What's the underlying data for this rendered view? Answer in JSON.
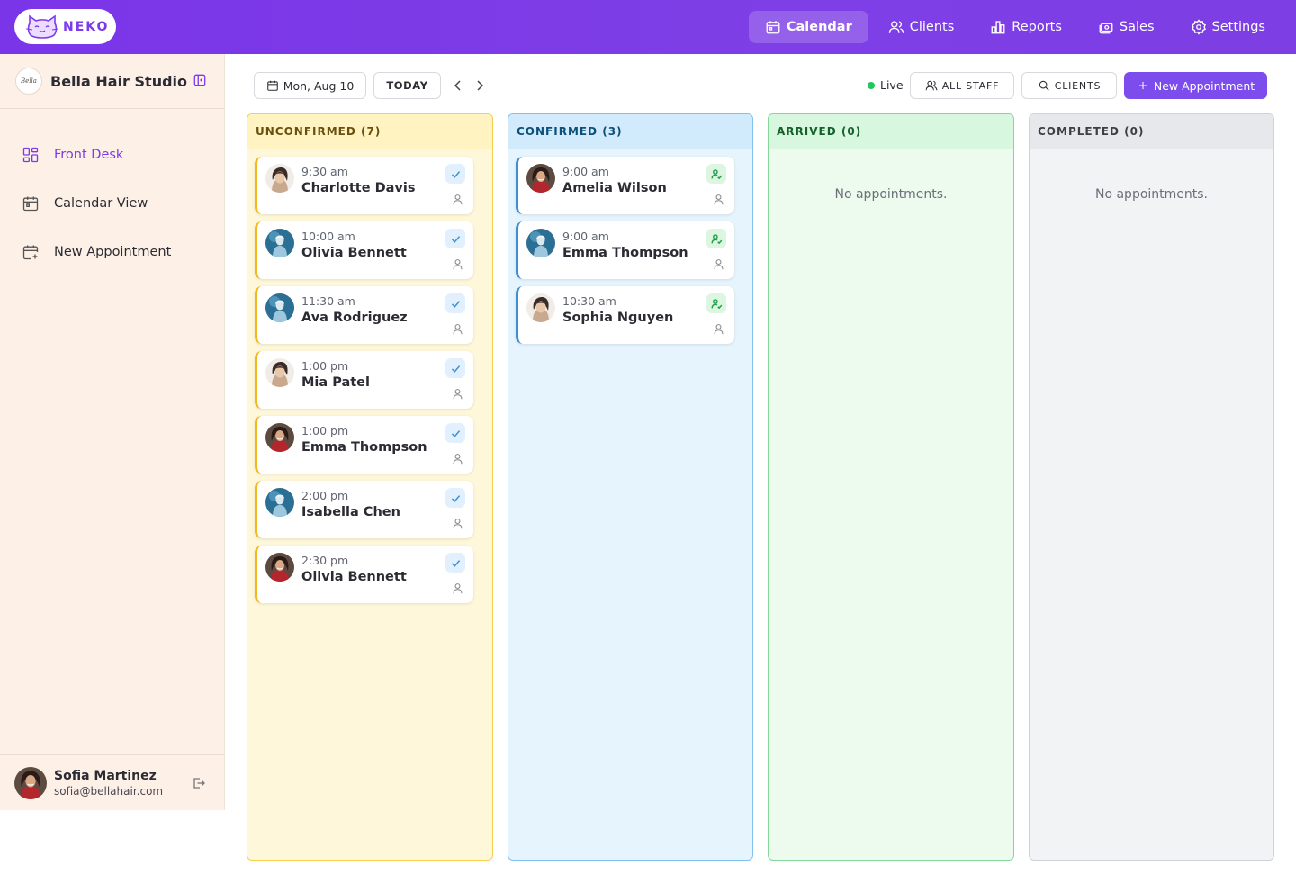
{
  "app": {
    "logo_text": "NEKO",
    "brand_color": "#7c3aed"
  },
  "topnav": {
    "items": [
      {
        "label": "Calendar",
        "icon": "calendar-icon",
        "active": true
      },
      {
        "label": "Clients",
        "icon": "users-icon",
        "active": false
      },
      {
        "label": "Reports",
        "icon": "bar-chart-icon",
        "active": false
      },
      {
        "label": "Sales",
        "icon": "register-icon",
        "active": false
      },
      {
        "label": "Settings",
        "icon": "gear-icon",
        "active": false
      }
    ]
  },
  "sidebar": {
    "studio_name": "Bella Hair Studio",
    "studio_logo_text": "Bella",
    "items": [
      {
        "label": "Front Desk",
        "icon": "dashboard-grid-icon",
        "active": true
      },
      {
        "label": "Calendar View",
        "icon": "calendar-icon",
        "active": false
      },
      {
        "label": "New Appointment",
        "icon": "calendar-plus-icon",
        "active": false
      }
    ],
    "user": {
      "name": "Sofia Martinez",
      "email": "sofia@bellahair.com"
    }
  },
  "toolbar": {
    "date_label": "Mon, Aug 10",
    "today_label": "TODAY",
    "live_label": "Live",
    "staff_label": "ALL STAFF",
    "clients_label": "CLIENTS",
    "new_label": "New Appointment"
  },
  "columns": {
    "unconfirmed": {
      "title": "UNCONFIRMED (7)",
      "cards": [
        {
          "time": "9:30 am",
          "name": "Charlotte Davis"
        },
        {
          "time": "10:00 am",
          "name": "Olivia Bennett"
        },
        {
          "time": "11:30 am",
          "name": "Ava Rodriguez"
        },
        {
          "time": "1:00 pm",
          "name": "Mia Patel"
        },
        {
          "time": "1:00 pm",
          "name": "Emma Thompson"
        },
        {
          "time": "2:00 pm",
          "name": "Isabella Chen"
        },
        {
          "time": "2:30 pm",
          "name": "Olivia Bennett"
        }
      ]
    },
    "confirmed": {
      "title": "CONFIRMED (3)",
      "cards": [
        {
          "time": "9:00 am",
          "name": "Amelia Wilson"
        },
        {
          "time": "9:00 am",
          "name": "Emma Thompson"
        },
        {
          "time": "10:30 am",
          "name": "Sophia Nguyen"
        }
      ]
    },
    "arrived": {
      "title": "ARRIVED (0)",
      "empty": "No appointments."
    },
    "completed": {
      "title": "COMPLETED (0)",
      "empty": "No appointments."
    }
  }
}
